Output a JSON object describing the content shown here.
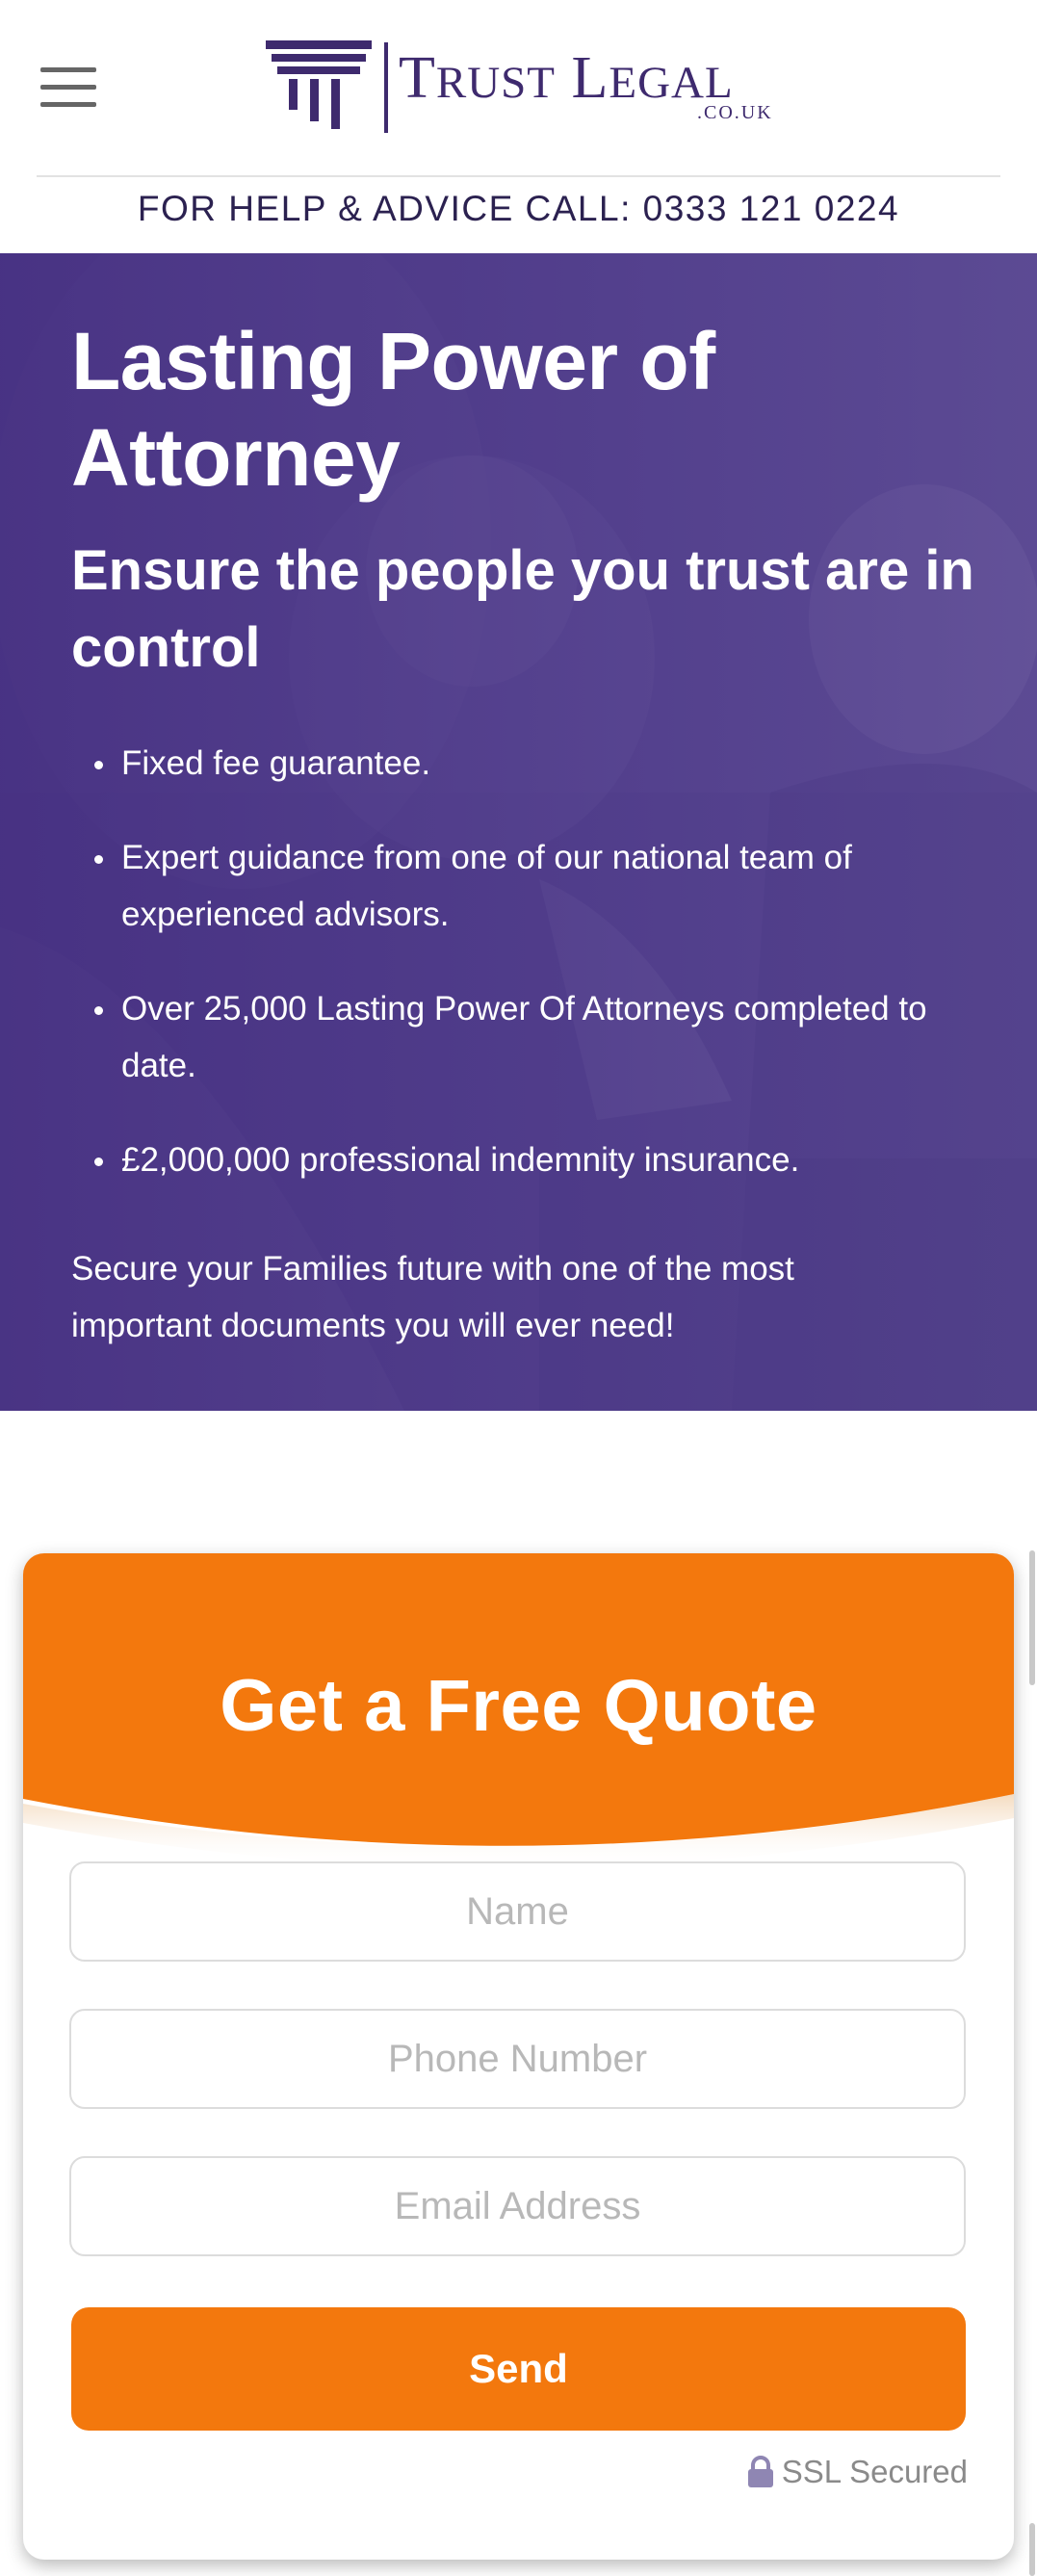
{
  "header": {
    "menu_icon": "hamburger-menu-icon",
    "logo": {
      "name_first_initial": "T",
      "name_first_rest": "RUST",
      "name_second_initial": "L",
      "name_second_rest": "EGAL",
      "domain": ".CO.UK",
      "icon": "columns-logo-icon",
      "brand_color": "#3e2a6e"
    },
    "helpline": "FOR HELP & ADVICE CALL: 0333 121 0224"
  },
  "hero": {
    "title": "Lasting Power of Attorney",
    "subtitle": "Ensure the people you trust are in control",
    "bullets": [
      "Fixed fee guarantee.",
      "Expert guidance from one of our national team of experienced advisors.",
      "Over 25,000 Lasting Power Of Attorneys completed to date.",
      "£2,000,000 professional indemnity insurance."
    ],
    "tagline": "Secure your Families future with one of the most important documents you will ever need!",
    "overlay_color": "#4d3a86"
  },
  "quote_form": {
    "title": "Get a Free Quote",
    "name_placeholder": "Name",
    "phone_placeholder": "Phone Number",
    "email_placeholder": "Email Address",
    "send_label": "Send",
    "ssl_label": "SSL Secured",
    "ssl_icon": "lock-icon",
    "accent_color": "#f3780d"
  }
}
